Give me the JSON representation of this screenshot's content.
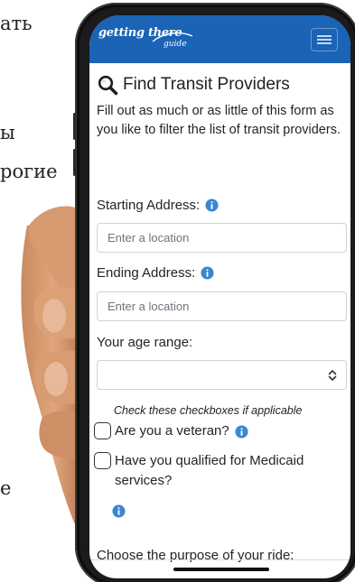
{
  "background_text": {
    "line1": "ать",
    "line2": "ы",
    "line3": "рогие",
    "line4": "е"
  },
  "app": {
    "logo_main": "getting there",
    "logo_sub": "guide",
    "brand_color": "#1a63b5"
  },
  "page": {
    "title": "Find Transit Providers",
    "title_icon": "search-icon",
    "description": "Fill out as much or as little of this form as you like to filter the list of transit providers."
  },
  "form": {
    "starting_address": {
      "label": "Starting Address:",
      "placeholder": "Enter a location",
      "value": ""
    },
    "ending_address": {
      "label": "Ending Address:",
      "placeholder": "Enter a location",
      "value": ""
    },
    "age_range": {
      "label": "Your age range:",
      "selected": ""
    },
    "checkbox_hint": "Check these checkboxes if applicable",
    "veteran": {
      "label": "Are you a veteran?",
      "checked": false
    },
    "medicaid": {
      "label": "Have you qualified for Medicaid services?",
      "checked": false
    },
    "purpose_label": "Choose the purpose of your ride:"
  },
  "colors": {
    "info_icon": "#3b86d1",
    "input_border": "#ced4da"
  }
}
